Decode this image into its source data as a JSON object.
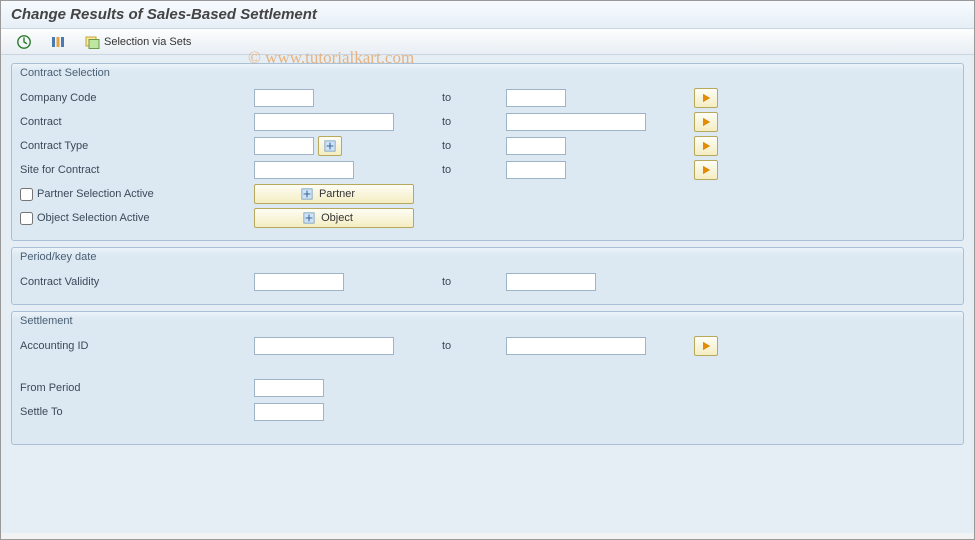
{
  "title": "Change Results of Sales-Based Settlement",
  "toolbar": {
    "selection_via_sets": "Selection via Sets"
  },
  "watermark": "© www.tutorialkart.com",
  "groups": {
    "contract": {
      "title": "Contract Selection",
      "rows": {
        "company_code": {
          "label": "Company Code",
          "to": "to"
        },
        "contract": {
          "label": "Contract",
          "to": "to"
        },
        "contract_type": {
          "label": "Contract Type",
          "to": "to"
        },
        "site": {
          "label": "Site for Contract",
          "to": "to"
        },
        "partner_sel": {
          "label": "Partner Selection Active",
          "btn": "Partner"
        },
        "object_sel": {
          "label": "Object Selection Active",
          "btn": "Object"
        }
      }
    },
    "period": {
      "title": "Period/key date",
      "rows": {
        "validity": {
          "label": "Contract Validity",
          "to": "to"
        }
      }
    },
    "settlement": {
      "title": "Settlement",
      "rows": {
        "accounting_id": {
          "label": "Accounting ID",
          "to": "to"
        },
        "from_period": {
          "label": "From Period"
        },
        "settle_to": {
          "label": "Settle To"
        }
      }
    }
  }
}
